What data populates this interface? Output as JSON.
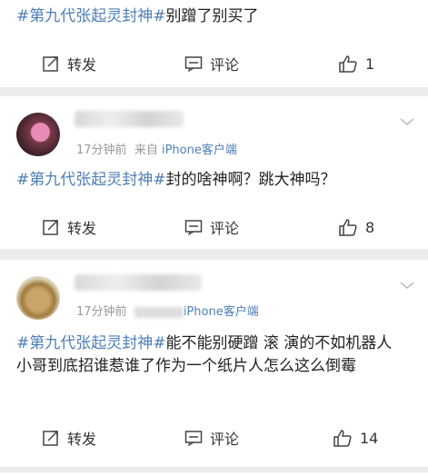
{
  "posts": [
    {
      "hashtag": "#第九代张起灵封神#",
      "text": "别蹭了别买了",
      "repost_label": "转发",
      "comment_label": "评论",
      "like_count": "1"
    },
    {
      "time": "17分钟前",
      "source_prefix": "来自",
      "source": "iPhone客户端",
      "hashtag": "#第九代张起灵封神#",
      "text": "封的啥神啊？跳大神吗？",
      "repost_label": "转发",
      "comment_label": "评论",
      "like_count": "8"
    },
    {
      "time": "17分钟前",
      "source": "iPhone客户端",
      "hashtag": "#第九代张起灵封神#",
      "text": "能不能别硬蹭 滚 演的不如机器人 小哥到底招谁惹谁了作为一个纸片人怎么这么倒霉",
      "repost_label": "转发",
      "comment_label": "评论",
      "like_count": "14"
    }
  ],
  "colors": {
    "link": "#4e7eb6",
    "background": "#ececec"
  },
  "icons": [
    "repost-icon",
    "comment-icon",
    "like-icon",
    "chevron-down-icon"
  ]
}
